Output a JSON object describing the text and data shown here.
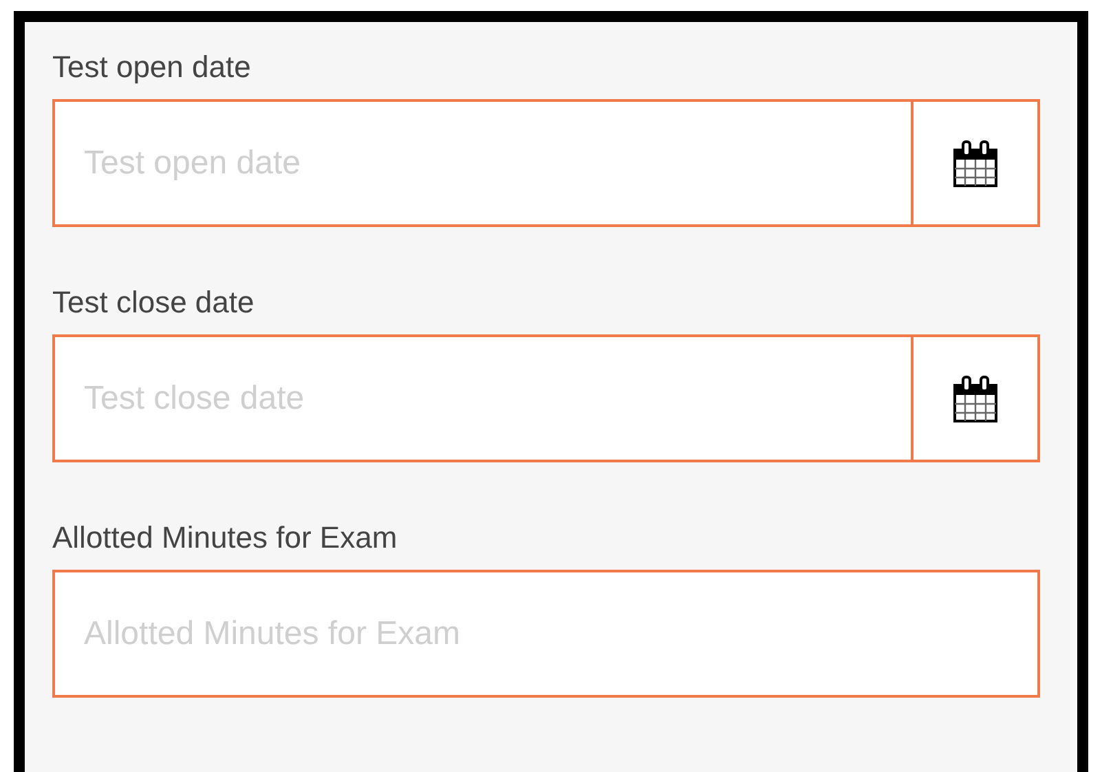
{
  "fields": [
    {
      "label": "Test open date",
      "placeholder": "Test open date",
      "kind": "date"
    },
    {
      "label": "Test close date",
      "placeholder": "Test close date",
      "kind": "date"
    },
    {
      "label": "Allotted Minutes for Exam",
      "placeholder": "Allotted Minutes for Exam",
      "kind": "text"
    }
  ]
}
